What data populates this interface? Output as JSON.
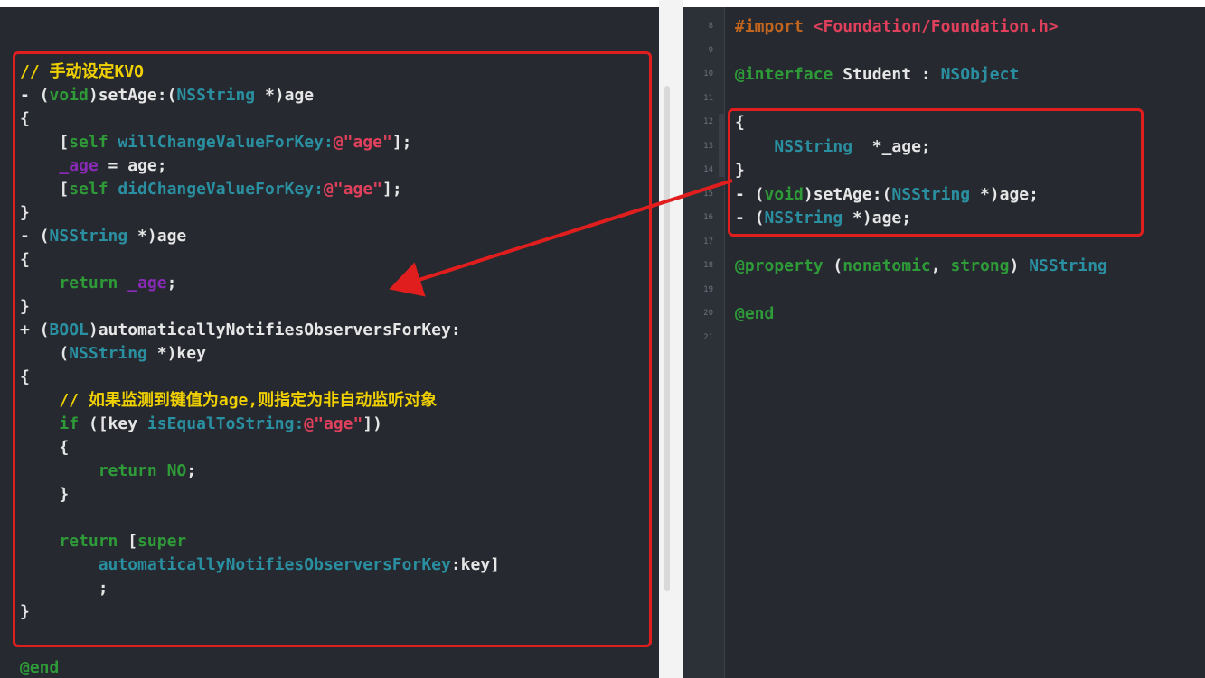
{
  "left_editor": {
    "lines": [
      [
        {
          "t": "// 手动设定KVO",
          "c": "cmt"
        }
      ],
      [
        {
          "t": "- (",
          "c": "plain"
        },
        {
          "t": "void",
          "c": "kw"
        },
        {
          "t": ")setAge:(",
          "c": "plain"
        },
        {
          "t": "NSString",
          "c": "type"
        },
        {
          "t": " *)age",
          "c": "plain"
        }
      ],
      [
        {
          "t": "{",
          "c": "plain"
        }
      ],
      [
        {
          "t": "    [",
          "c": "plain"
        },
        {
          "t": "self",
          "c": "kw"
        },
        {
          "t": " willChangeValueForKey:",
          "c": "type"
        },
        {
          "t": "@\"age\"",
          "c": "str"
        },
        {
          "t": "];",
          "c": "plain"
        }
      ],
      [
        {
          "t": "    ",
          "c": "plain"
        },
        {
          "t": "_age",
          "c": "ivar"
        },
        {
          "t": " = age;",
          "c": "plain"
        }
      ],
      [
        {
          "t": "    [",
          "c": "plain"
        },
        {
          "t": "self",
          "c": "kw"
        },
        {
          "t": " didChangeValueForKey:",
          "c": "type"
        },
        {
          "t": "@\"age\"",
          "c": "str"
        },
        {
          "t": "];",
          "c": "plain"
        }
      ],
      [
        {
          "t": "}",
          "c": "plain"
        }
      ],
      [
        {
          "t": "- (",
          "c": "plain"
        },
        {
          "t": "NSString",
          "c": "type"
        },
        {
          "t": " *)age",
          "c": "plain"
        }
      ],
      [
        {
          "t": "{",
          "c": "plain"
        }
      ],
      [
        {
          "t": "    ",
          "c": "plain"
        },
        {
          "t": "return",
          "c": "kw"
        },
        {
          "t": " ",
          "c": "plain"
        },
        {
          "t": "_age",
          "c": "ivar"
        },
        {
          "t": ";",
          "c": "plain"
        }
      ],
      [
        {
          "t": "}",
          "c": "plain"
        }
      ],
      [
        {
          "t": "+ (",
          "c": "plain"
        },
        {
          "t": "BOOL",
          "c": "type"
        },
        {
          "t": ")automaticallyNotifiesObserversForKey:",
          "c": "plain"
        }
      ],
      [
        {
          "t": "    (",
          "c": "plain"
        },
        {
          "t": "NSString",
          "c": "type"
        },
        {
          "t": " *)key",
          "c": "plain"
        }
      ],
      [
        {
          "t": "{",
          "c": "plain"
        }
      ],
      [
        {
          "t": "    // 如果监测到键值为age,则指定为非自动监听对象",
          "c": "cmt"
        }
      ],
      [
        {
          "t": "    ",
          "c": "plain"
        },
        {
          "t": "if",
          "c": "kw"
        },
        {
          "t": " ([key ",
          "c": "plain"
        },
        {
          "t": "isEqualToString:",
          "c": "type"
        },
        {
          "t": "@\"age\"",
          "c": "str"
        },
        {
          "t": "])",
          "c": "plain"
        }
      ],
      [
        {
          "t": "    {",
          "c": "plain"
        }
      ],
      [
        {
          "t": "        ",
          "c": "plain"
        },
        {
          "t": "return",
          "c": "kw"
        },
        {
          "t": " ",
          "c": "plain"
        },
        {
          "t": "NO",
          "c": "kw"
        },
        {
          "t": ";",
          "c": "plain"
        }
      ],
      [
        {
          "t": "    }",
          "c": "plain"
        }
      ],
      [
        {
          "t": "",
          "c": "plain"
        }
      ],
      [
        {
          "t": "    ",
          "c": "plain"
        },
        {
          "t": "return",
          "c": "kw"
        },
        {
          "t": " [",
          "c": "plain"
        },
        {
          "t": "super",
          "c": "kw"
        }
      ],
      [
        {
          "t": "        automaticallyNotifiesObserversForKey",
          "c": "type"
        },
        {
          "t": ":key]",
          "c": "plain"
        }
      ],
      [
        {
          "t": "        ;",
          "c": "plain"
        }
      ],
      [
        {
          "t": "}",
          "c": "plain"
        }
      ]
    ],
    "end_label": "@end"
  },
  "right_editor": {
    "line_numbers": [
      "8",
      "9",
      "10",
      "11",
      "12",
      "13",
      "14",
      "15",
      "16",
      "17",
      "18",
      "19",
      "20",
      "21"
    ],
    "lines": [
      [
        {
          "t": "#import",
          "c": "dir"
        },
        {
          "t": " <Foundation/Foundation.h>",
          "c": "inc"
        }
      ],
      [
        {
          "t": "",
          "c": "plain"
        }
      ],
      [
        {
          "t": "@interface",
          "c": "at"
        },
        {
          "t": " Student : ",
          "c": "plain"
        },
        {
          "t": "NSObject",
          "c": "type"
        }
      ],
      [
        {
          "t": "",
          "c": "plain"
        }
      ],
      [
        {
          "t": "{",
          "c": "plain"
        }
      ],
      [
        {
          "t": "    ",
          "c": "plain"
        },
        {
          "t": "NSString",
          "c": "type"
        },
        {
          "t": "  *_age;",
          "c": "plain"
        }
      ],
      [
        {
          "t": "}",
          "c": "plain"
        }
      ],
      [
        {
          "t": "- (",
          "c": "plain"
        },
        {
          "t": "void",
          "c": "kw"
        },
        {
          "t": ")setAge:(",
          "c": "plain"
        },
        {
          "t": "NSString",
          "c": "type"
        },
        {
          "t": " *)age;",
          "c": "plain"
        }
      ],
      [
        {
          "t": "- (",
          "c": "plain"
        },
        {
          "t": "NSString",
          "c": "type"
        },
        {
          "t": " *)age;",
          "c": "plain"
        }
      ],
      [
        {
          "t": "",
          "c": "plain"
        }
      ],
      [
        {
          "t": "@property",
          "c": "at"
        },
        {
          "t": " (",
          "c": "plain"
        },
        {
          "t": "nonatomic",
          "c": "kw"
        },
        {
          "t": ", ",
          "c": "plain"
        },
        {
          "t": "strong",
          "c": "kw"
        },
        {
          "t": ") ",
          "c": "plain"
        },
        {
          "t": "NSString",
          "c": "type"
        }
      ],
      [
        {
          "t": "",
          "c": "plain"
        }
      ],
      [
        {
          "t": "@end",
          "c": "at"
        }
      ],
      [
        {
          "t": "",
          "c": "plain"
        }
      ]
    ]
  },
  "colors": {
    "editor_bg": "#262a30",
    "annotation_red": "#e11e1e",
    "keyword": "#2e9a38",
    "type": "#2a8fa0",
    "string": "#e0405c",
    "ivar": "#8a2bb8",
    "comment": "#f0d000"
  }
}
